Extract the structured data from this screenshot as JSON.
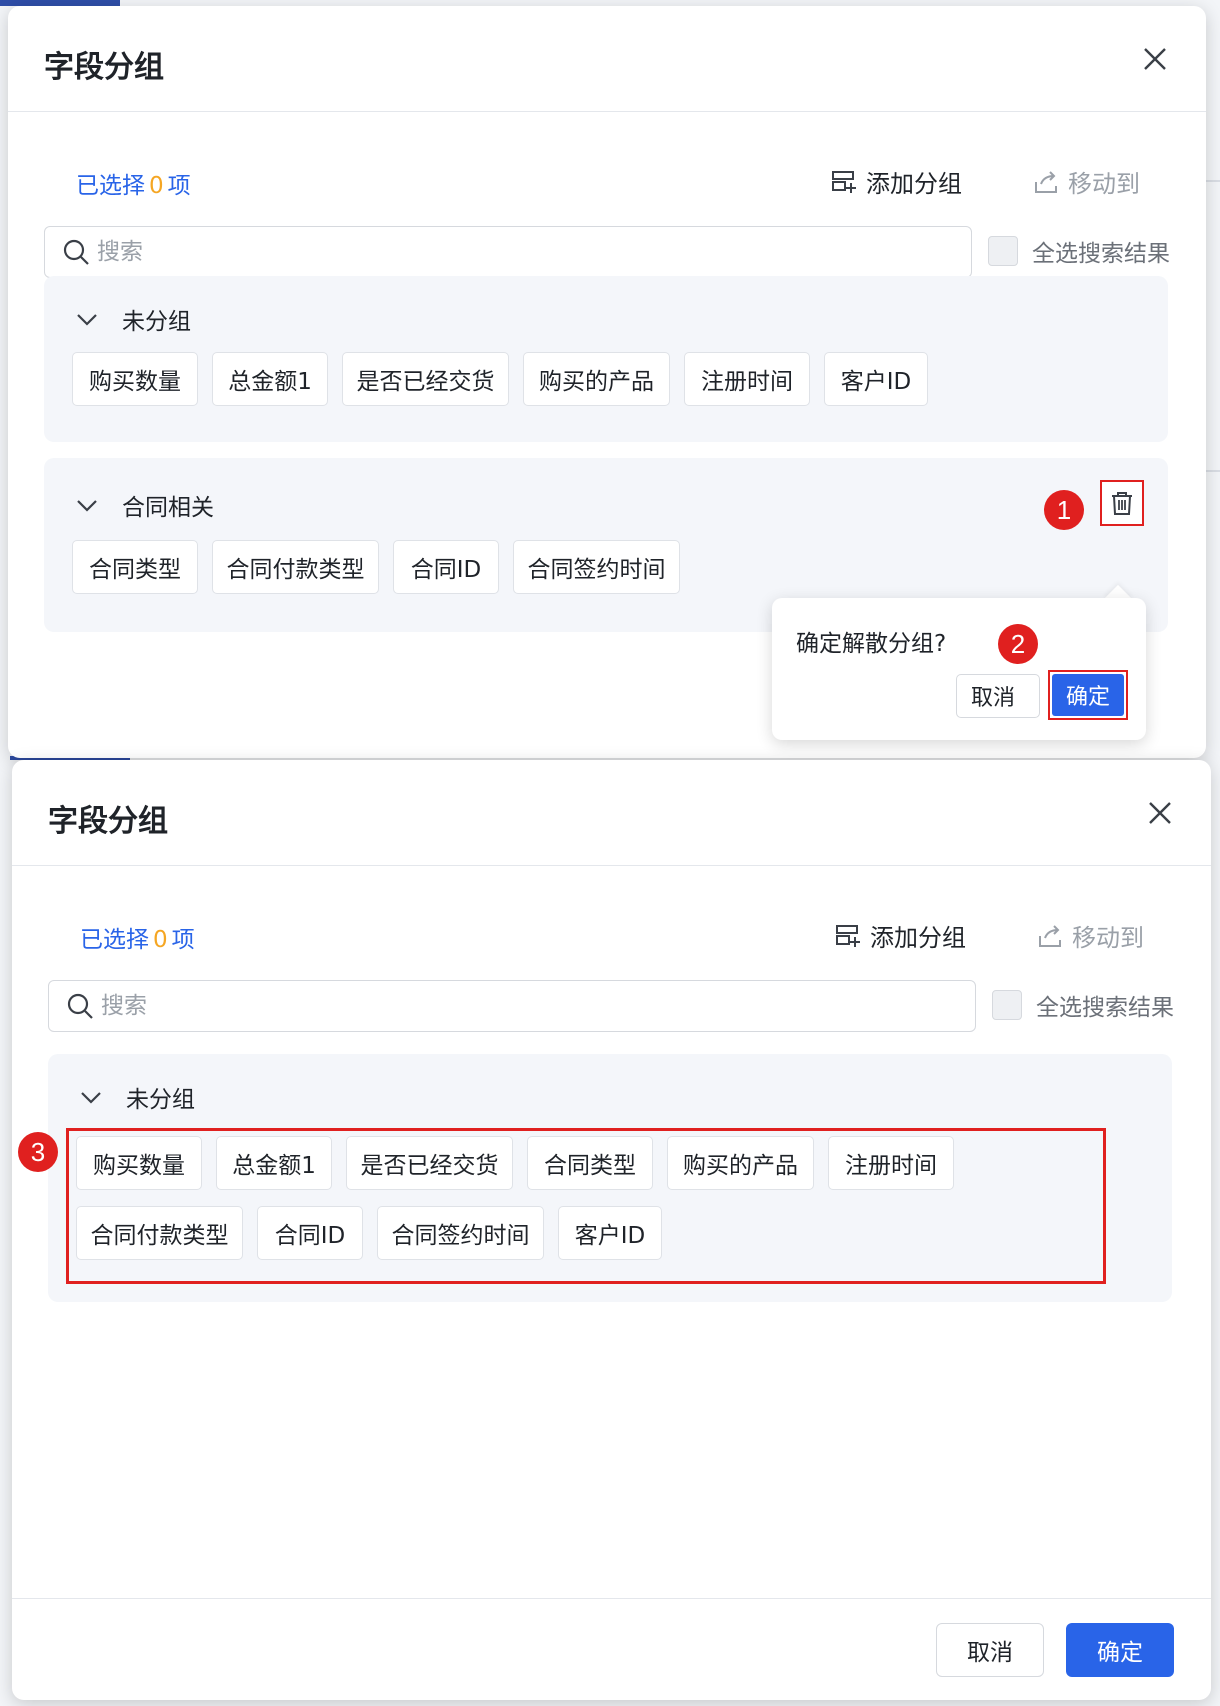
{
  "dialog_title": "字段分组",
  "selected": {
    "prefix": "已选择",
    "count": "0",
    "suffix": "项"
  },
  "toolbar": {
    "add_group": "添加分组",
    "move_to": "移动到"
  },
  "search": {
    "placeholder": "搜索"
  },
  "select_all_label": "全选搜索结果",
  "before": {
    "groups": [
      {
        "name": "未分组",
        "fields": [
          "购买数量",
          "总金额1",
          "是否已经交货",
          "购买的产品",
          "注册时间",
          "客户ID"
        ]
      },
      {
        "name": "合同相关",
        "fields": [
          "合同类型",
          "合同付款类型",
          "合同ID",
          "合同签约时间"
        ]
      }
    ],
    "popconfirm": {
      "message": "确定解散分组?",
      "cancel": "取消",
      "ok": "确定"
    }
  },
  "after": {
    "groups": [
      {
        "name": "未分组",
        "fields": [
          "购买数量",
          "总金额1",
          "是否已经交货",
          "合同类型",
          "购买的产品",
          "注册时间",
          "合同付款类型",
          "合同ID",
          "合同签约时间",
          "客户ID"
        ]
      }
    ]
  },
  "footer": {
    "cancel": "取消",
    "ok": "确定"
  },
  "markers": [
    "1",
    "2",
    "3"
  ],
  "colors": {
    "primary": "#2964e8",
    "count_highlight": "#f5a623",
    "annotation_red": "#e0201f",
    "panel_bg": "#f4f6fa"
  }
}
